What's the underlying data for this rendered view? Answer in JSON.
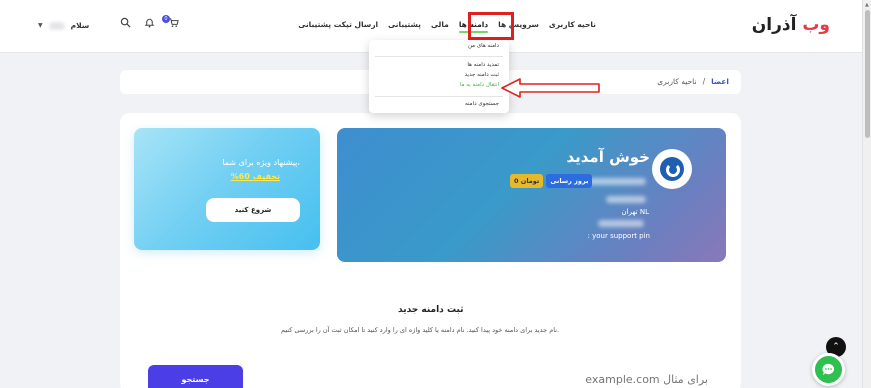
{
  "header": {
    "logo_main": "آذران",
    "logo_accent": "وب",
    "nav": [
      {
        "label": "ناحیه کاربری",
        "name": "nav-user-area"
      },
      {
        "label": "سرویس ها",
        "name": "nav-services"
      },
      {
        "label": "دامنه ها",
        "name": "nav-domains"
      },
      {
        "label": "مالی",
        "name": "nav-finance"
      },
      {
        "label": "پشتیبانی",
        "name": "nav-support"
      },
      {
        "label": "ارسال تیکت پشتیبانی",
        "name": "nav-open-ticket"
      }
    ],
    "greeting": "سلام",
    "cart_count": "0"
  },
  "domains_menu": {
    "items": [
      {
        "label": "دامنه های من"
      },
      {
        "label": "تمدید دامنه ها"
      },
      {
        "label": "ثبت دامنه جدید"
      },
      {
        "label": "انتقال دامنه به ما"
      },
      {
        "label": "جستجوی دامنه"
      }
    ]
  },
  "breadcrumb": {
    "home": "اعضا",
    "separator": "/",
    "current": "ناحیه کاربری"
  },
  "welcome": {
    "title": "خوش آمدید",
    "renew_label": "بروز رسانی",
    "credit_label": "0 تومان",
    "city": "تهران NL",
    "support_pin": ": your support pin"
  },
  "offer": {
    "line1": "پیشنهاد ویژه برای شما،",
    "line2": "%60 تخفیف",
    "button": "شروع کنید"
  },
  "register": {
    "title": "ثبت دامنه جدید",
    "description": "نام جدید برای دامنه خود پیدا کنید. نام دامنه یا کلید واژه ای را وارد کنید تا امکان ثبت آن را بررسی کنیم.",
    "placeholder": "برای مثال example.com",
    "button": "جستجو"
  },
  "colors": {
    "accent": "#4b3ee6",
    "annotation": "#e02020",
    "menu_highlight": "#45b34a"
  }
}
